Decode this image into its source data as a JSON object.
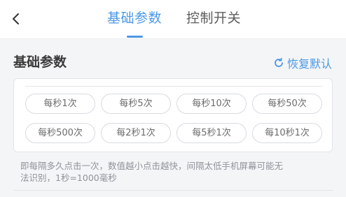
{
  "header": {
    "tabs": [
      {
        "label": "基础参数",
        "active": true
      },
      {
        "label": "控制开关",
        "active": false
      }
    ]
  },
  "section": {
    "title": "基础参数",
    "restore_label": "恢复默认"
  },
  "options": [
    "每秒1次",
    "每秒5次",
    "每秒10次",
    "每秒50次",
    "每秒500次",
    "每2秒1次",
    "每5秒1次",
    "每10秒1次"
  ],
  "description_lines": [
    "即每隔多久点击一次，数值越小点击越快，间隔太低手机屏幕可能无",
    "法识别，1秒=1000毫秒"
  ],
  "colors": {
    "accent": "#4a98e6",
    "background": "#f4f5f7",
    "text_primary": "#3a3a3a",
    "text_secondary": "#8f9399"
  },
  "icons": {
    "back": "chevron-left-icon",
    "restore": "refresh-icon"
  }
}
